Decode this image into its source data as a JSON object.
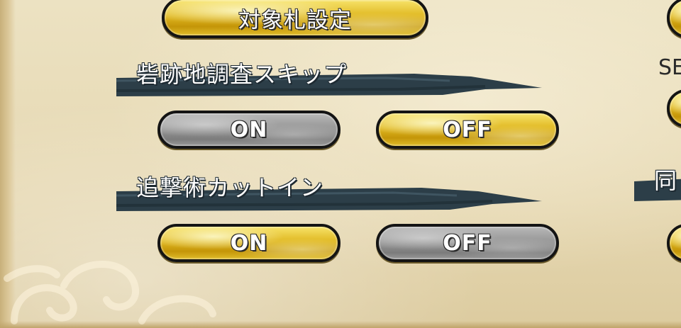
{
  "top_button": {
    "label": "対象札設定"
  },
  "sections": [
    {
      "title": "砦跡地調査スキップ",
      "options": [
        {
          "label": "ON",
          "selected": false
        },
        {
          "label": "OFF",
          "selected": true
        }
      ]
    },
    {
      "title": "追撃術カットイン",
      "options": [
        {
          "label": "ON",
          "selected": true
        },
        {
          "label": "OFF",
          "selected": false
        }
      ]
    }
  ],
  "right_column": {
    "partial_label_top": "SE",
    "partial_section_title": "同"
  },
  "colors": {
    "gold": "#e0b821",
    "gray": "#8f8f8f",
    "ink": "#1e2a32",
    "parchment": "#e9dcb8"
  }
}
